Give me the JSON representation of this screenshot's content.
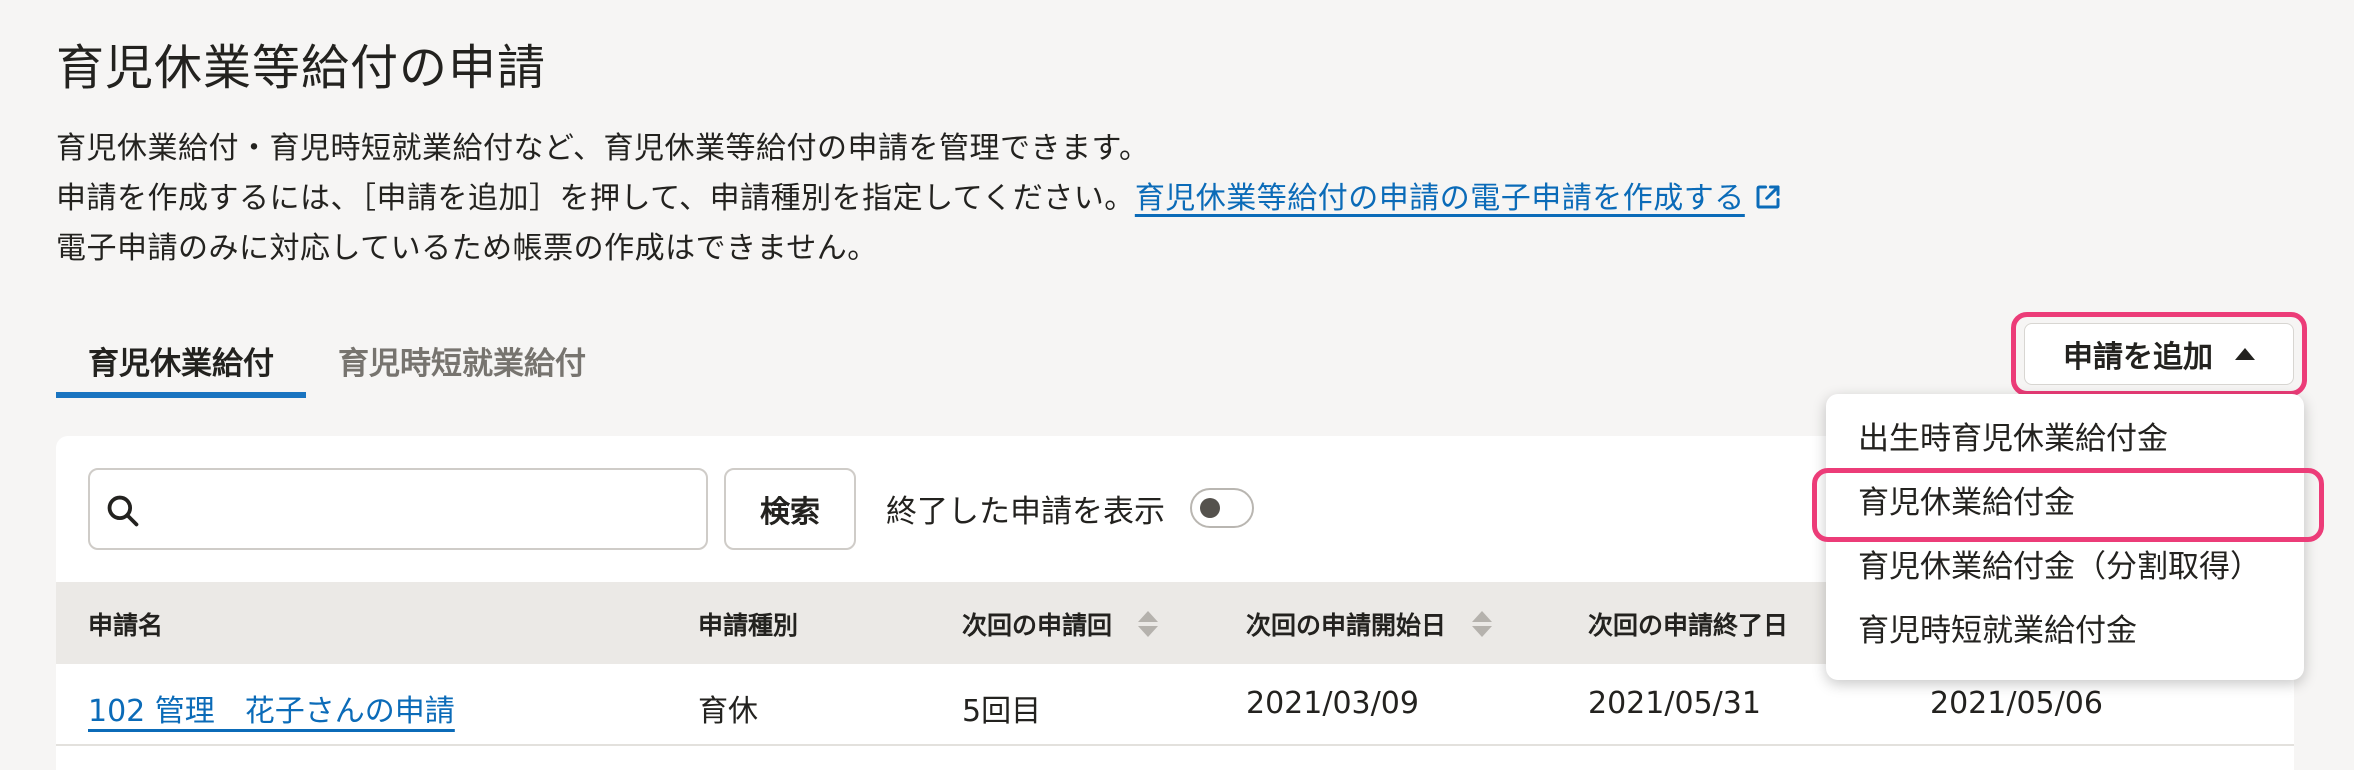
{
  "page": {
    "title": "育児休業等給付の申請",
    "description": {
      "line1": "育児休業給付・育児時短就業給付など、育児休業等給付の申請を管理できます。",
      "line2_text": "申請を作成するには、［申請を追加］を押して、申請種別を指定してください。",
      "line2_link": "育児休業等給付の申請の電子申請を作成する",
      "line3": "電子申請のみに対応しているため帳票の作成はできません。"
    }
  },
  "tabs": [
    {
      "label": "育児休業給付",
      "active": true
    },
    {
      "label": "育児時短就業給付",
      "active": false
    }
  ],
  "add_button": {
    "label": "申請を追加"
  },
  "dropdown": {
    "items": [
      {
        "label": "出生時育児休業給付金"
      },
      {
        "label": "育児休業給付金"
      },
      {
        "label": "育児休業給付金（分割取得）"
      },
      {
        "label": "育児時短就業給付金"
      }
    ]
  },
  "search": {
    "placeholder": "",
    "button_label": "検索"
  },
  "filter": {
    "show_ended_label": "終了した申請を表示",
    "show_ended": false
  },
  "table": {
    "columns": [
      "申請名",
      "申請種別",
      "次回の申請回",
      "次回の申請開始日",
      "次回の申請終了日"
    ],
    "rows": [
      [
        "102 管理　花子さんの申請",
        "育休",
        "5回目",
        "2021/03/09",
        "2021/05/31",
        "2021/05/06"
      ]
    ]
  },
  "colors": {
    "accent": "#1a74c0",
    "link": "#0b6bb8",
    "highlight": "#ec3c78"
  }
}
